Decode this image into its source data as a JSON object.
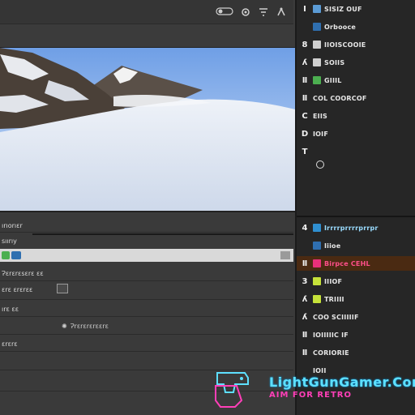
{
  "toolbar": {
    "icons": [
      "toggle-icon",
      "settings-icon",
      "filter-icon",
      "share-icon"
    ]
  },
  "viewer": {
    "scene": "snowy-mountain"
  },
  "left_panel": {
    "rows": [
      {
        "label": "ırıorıɛr"
      },
      {
        "label": "sıırıy"
      },
      {
        "label": "Ɂɛrɛrɛsɛrɛ ɛɛ"
      },
      {
        "label": "ɛrɛ ɛrɛrɛɛ"
      },
      {
        "label": "ırɛ ɛɛ"
      },
      {
        "label": "ɛrɛrɛ"
      }
    ],
    "center_button": "Ɂrɛrɛrɛrɛɛrɛ"
  },
  "sidebar": {
    "top_items": [
      {
        "key": "Ⅰ",
        "chip": "#5b9bd5",
        "text": "SISIZ OUF"
      },
      {
        "key": "",
        "chip": "#2f6fb0",
        "text": "Orbooce"
      },
      {
        "key": "8",
        "chip": "#cfcfcf",
        "text": "IIOISCOOIE"
      },
      {
        "key": "ʎ",
        "chip": "#cfcfcf",
        "text": "SOIIS"
      },
      {
        "key": "Ⅱ",
        "chip": "#4caf50",
        "text": "GIIIL"
      },
      {
        "key": "Ⅱ",
        "chip": "",
        "text": "COL COORCOF"
      },
      {
        "key": "C",
        "chip": "",
        "text": "EIIS"
      },
      {
        "key": "D",
        "chip": "",
        "text": "IOIF"
      },
      {
        "key": "T",
        "chip": "",
        "text": ""
      }
    ],
    "bottom_items": [
      {
        "key": "4",
        "chip": "#2f8fd0",
        "text": "Irrrrprrrrprrpr"
      },
      {
        "key": "",
        "chip": "#2f6fb0",
        "text": "Iiioe"
      },
      {
        "key": "Ⅱ",
        "chip": "#e8307a",
        "text": "Birpce CEHL"
      },
      {
        "key": "3",
        "chip": "#c6e23a",
        "text": "IIIOF"
      },
      {
        "key": "ʎ",
        "chip": "#c6e23a",
        "text": "TRIIII"
      },
      {
        "key": "ʎ",
        "chip": "",
        "text": "COO SCIIIIIF"
      },
      {
        "key": "Ⅱ",
        "chip": "",
        "text": "IOIIIIIC IF"
      },
      {
        "key": "Ⅱ",
        "chip": "",
        "text": "CORIORIE"
      },
      {
        "key": "",
        "chip": "",
        "text": "IOII"
      }
    ]
  },
  "watermark": {
    "title": "LightGunGamer.Com",
    "subtitle": "AIM FOR RETRO"
  }
}
